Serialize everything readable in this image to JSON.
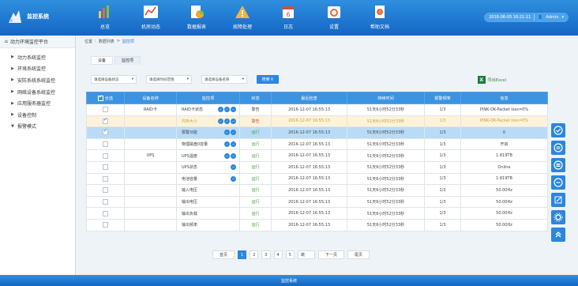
{
  "app": {
    "title": "监控系统"
  },
  "nav": [
    {
      "label": "总览",
      "icon": "bar-chart-icon"
    },
    {
      "label": "机房动态",
      "icon": "line-chart-icon"
    },
    {
      "label": "数据报表",
      "icon": "report-icon"
    },
    {
      "label": "故障处理",
      "icon": "warning-icon"
    },
    {
      "label": "日志",
      "icon": "calendar-icon"
    },
    {
      "label": "设置",
      "icon": "settings-icon"
    },
    {
      "label": "帮助文档",
      "icon": "help-doc-icon"
    }
  ],
  "user": {
    "datetime": "2016-06-05 16:21:11",
    "name": "Admin"
  },
  "sidebar": {
    "title": "动力环境监控平台",
    "items": [
      {
        "label": "动力系统监控",
        "arrow": "▶"
      },
      {
        "label": "环境系统监控",
        "arrow": "▶"
      },
      {
        "label": "安防系统系统监控",
        "arrow": "▶"
      },
      {
        "label": "网络设备系统监控",
        "arrow": "▶"
      },
      {
        "label": "应用服务器监控",
        "arrow": "▶"
      },
      {
        "label": "设备控制",
        "arrow": "▶"
      },
      {
        "label": "报警模式",
        "arrow": "▼"
      }
    ]
  },
  "breadcrumb": {
    "root": "位置",
    "parent": "数据列表",
    "current": "监控项"
  },
  "tabs": [
    {
      "label": "设备"
    },
    {
      "label": "监控项"
    }
  ],
  "filters": [
    {
      "label": "请选择设备状态"
    },
    {
      "label": "请选择时间范围"
    },
    {
      "label": "请选择设备名称"
    }
  ],
  "search": {
    "label": "搜索"
  },
  "export": {
    "label": "导出Excel"
  },
  "table": {
    "headers": [
      "全选",
      "设备名称",
      "监控项",
      "状态",
      "最近检查",
      "持续时间",
      "报警频率",
      "信息"
    ],
    "rows": [
      {
        "checked": false,
        "device": "RAID卡",
        "item": "RAID卡状态",
        "icons": 3,
        "status": "警告",
        "last": "2016-12-07 16:55:13",
        "duration": "51天6小时52分33秒",
        "freq": "1/3",
        "info": "PINK-OK-Packet loss=0%",
        "style": "normal",
        "status_style": "warn"
      },
      {
        "checked": true,
        "device": "",
        "item": "内存大小",
        "icons": 3,
        "status": "警告",
        "last": "2016-12-07 16:55:13",
        "duration": "51天6小时52分33秒",
        "freq": "1/3",
        "info": "PINK-OK-Packet loss=0%",
        "style": "warn",
        "status_style": "warn"
      },
      {
        "checked": true,
        "device": "",
        "item": "报警功能",
        "icons": 2,
        "status": "运行",
        "last": "2016-12-07 16:55:13",
        "duration": "51天6小时52分33秒",
        "freq": "1/3",
        "info": "0",
        "style": "selected",
        "status_style": "ok"
      },
      {
        "checked": false,
        "device": "",
        "item": "物理磁盘0容量",
        "icons": 2,
        "status": "运行",
        "last": "2016-12-07 16:55:13",
        "duration": "51天6小时52分33秒",
        "freq": "1/3",
        "info": "开启",
        "style": "normal",
        "status_style": "ok"
      },
      {
        "checked": false,
        "device": "UPS",
        "item": "UPS温度",
        "icons": 2,
        "status": "运行",
        "last": "2016-12-07 16:55:13",
        "duration": "51天6小时52分33秒",
        "freq": "1/3",
        "info": "1.819TB",
        "style": "normal",
        "status_style": "ok"
      },
      {
        "checked": false,
        "device": "",
        "item": "UPS状态",
        "icons": 1,
        "status": "运行",
        "last": "2016-12-07 16:55:13",
        "duration": "51天6小时52分33秒",
        "freq": "1/3",
        "info": "Online",
        "style": "normal",
        "status_style": "ok"
      },
      {
        "checked": false,
        "device": "",
        "item": "电池容量",
        "icons": 1,
        "status": "运行",
        "last": "2016-12-07 16:55:13",
        "duration": "51天6小时52分33秒",
        "freq": "1/3",
        "info": "1.819TB",
        "style": "normal",
        "status_style": "ok"
      },
      {
        "checked": false,
        "device": "",
        "item": "输入电压",
        "icons": 0,
        "status": "运行",
        "last": "2016-12-07 16:55:13",
        "duration": "51天6小时52分33秒",
        "freq": "1/3",
        "info": "50.00Hz",
        "style": "normal",
        "status_style": "ok"
      },
      {
        "checked": false,
        "device": "",
        "item": "输出电压",
        "icons": 0,
        "status": "运行",
        "last": "2016-12-07 16:55:13",
        "duration": "51天6小时52分33秒",
        "freq": "1/3",
        "info": "50.00Hz",
        "style": "normal",
        "status_style": "ok"
      },
      {
        "checked": false,
        "device": "",
        "item": "输出负载",
        "icons": 0,
        "status": "运行",
        "last": "2016-12-07 16:55:13",
        "duration": "51天6小时52分33秒",
        "freq": "1/3",
        "info": "50.00Hz",
        "style": "normal",
        "status_style": "ok"
      },
      {
        "checked": false,
        "device": "",
        "item": "输出频率",
        "icons": 0,
        "status": "运行",
        "last": "2016-12-07 16:55:13",
        "duration": "51天6小时52分33秒",
        "freq": "1/3",
        "info": "50.00Hz",
        "style": "normal",
        "status_style": "ok"
      }
    ]
  },
  "pagination": {
    "first": "首页",
    "pages": [
      "1",
      "2",
      "3",
      "4",
      "5"
    ],
    "current": "1",
    "input_value": "跳",
    "next": "下一页",
    "last": "尾页"
  },
  "tools": [
    "check-circle-icon",
    "list-icon",
    "menu-icon",
    "minus-icon",
    "edit-icon",
    "gear-icon",
    "double-up-icon"
  ],
  "footer": {
    "text": "监控系统"
  },
  "colors": {
    "primary": "#2b86e0",
    "header": "#1a6fcc",
    "warn_row": "#fdf3da",
    "selected_row": "#b9dbf6",
    "ok": "#3aa33a",
    "alert": "#d64a3b"
  }
}
